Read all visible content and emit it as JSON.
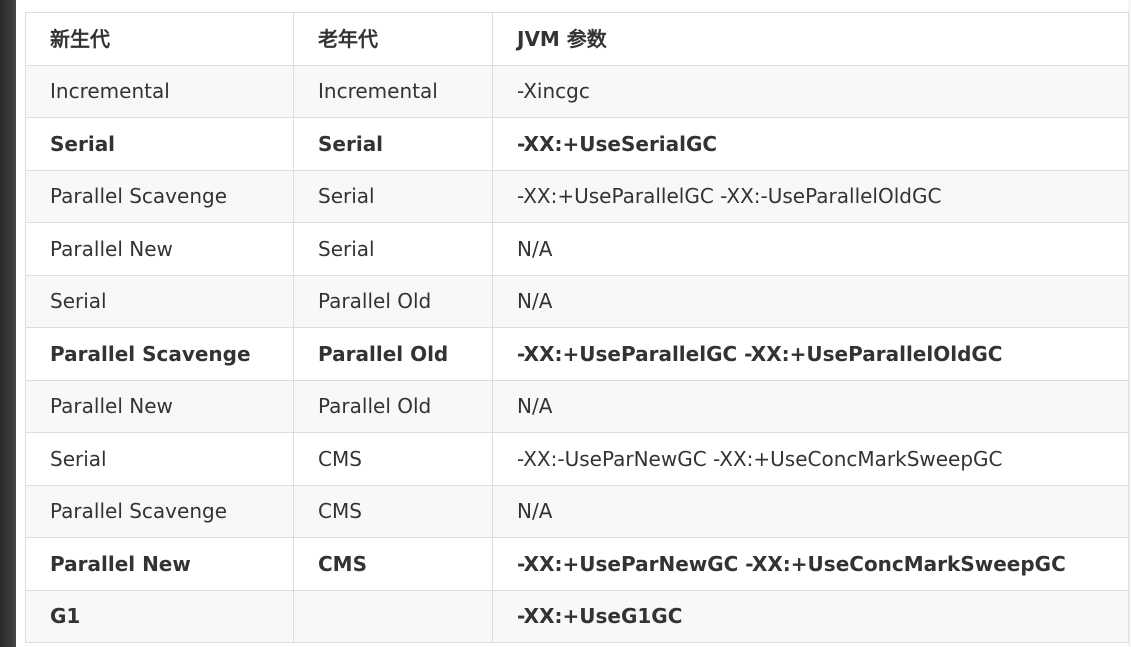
{
  "table": {
    "headers": [
      "新生代",
      "老年代",
      "JVM 参数"
    ],
    "rows": [
      {
        "young": "Incremental",
        "old": "Incremental",
        "param": "-Xincgc",
        "bold": false
      },
      {
        "young": "Serial",
        "old": "Serial",
        "param": "-XX:+UseSerialGC",
        "bold": true
      },
      {
        "young": "Parallel Scavenge",
        "old": "Serial",
        "param": "-XX:+UseParallelGC -XX:-UseParallelOldGC",
        "bold": false
      },
      {
        "young": "Parallel New",
        "old": "Serial",
        "param": "N/A",
        "bold": false
      },
      {
        "young": "Serial",
        "old": "Parallel Old",
        "param": "N/A",
        "bold": false
      },
      {
        "young": "Parallel Scavenge",
        "old": "Parallel Old",
        "param": "-XX:+UseParallelGC -XX:+UseParallelOldGC",
        "bold": true
      },
      {
        "young": "Parallel New",
        "old": "Parallel Old",
        "param": "N/A",
        "bold": false
      },
      {
        "young": "Serial",
        "old": "CMS",
        "param": "-XX:-UseParNewGC -XX:+UseConcMarkSweepGC",
        "bold": false
      },
      {
        "young": "Parallel Scavenge",
        "old": "CMS",
        "param": "N/A",
        "bold": false
      },
      {
        "young": "Parallel New",
        "old": "CMS",
        "param": "-XX:+UseParNewGC -XX:+UseConcMarkSweepGC",
        "bold": true
      },
      {
        "young": "G1",
        "old": "",
        "param": "-XX:+UseG1GC",
        "bold": true
      }
    ]
  }
}
